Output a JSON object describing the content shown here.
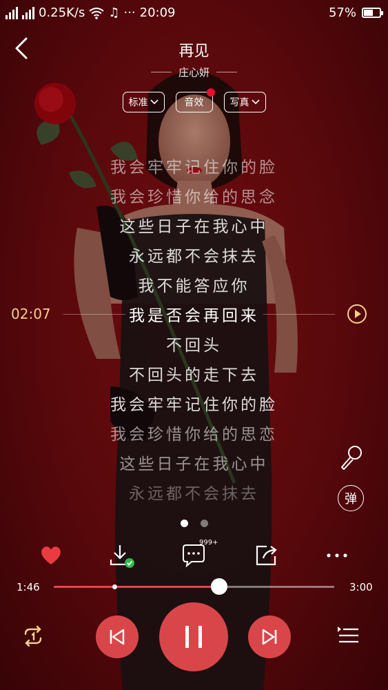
{
  "status_bar": {
    "network_speed": "0.25K/s",
    "time": "20:09",
    "battery": "57%",
    "battery_level": 0.57,
    "more": "···"
  },
  "player": {
    "title": "再见",
    "artist": "庄心妍",
    "tags": [
      {
        "label": "标准",
        "has_dropdown": true
      },
      {
        "label": "音效",
        "has_dot": true
      },
      {
        "label": "写真",
        "has_dropdown": true
      }
    ],
    "lyrics": [
      "我会牢牢记住你的脸",
      "我会珍惜你给的思念",
      "这些日子在我心中",
      "永远都不会抹去",
      "我不能答应你",
      "我是否会再回来",
      "不回头",
      "不回头的走下去",
      "我会牢牢记住你的脸",
      "我会珍惜你给的思恋",
      "这些日子在我心中",
      "永远都不会抹去"
    ],
    "seek_time": "02:07",
    "danmu_label": "弹",
    "comment_count": "999+",
    "current_time": "1:46",
    "total_time": "3:00",
    "progress": 0.589,
    "buffered": 0.215,
    "accent_color": "#d9464a",
    "highlight_color": "#f4d28a"
  },
  "icons": {
    "back": "chevron-left-icon",
    "favorite": "heart-icon",
    "download": "download-icon",
    "comment": "comment-icon",
    "share": "share-icon",
    "more": "more-icon",
    "loop": "repeat-icon",
    "prev": "previous-icon",
    "pause": "pause-icon",
    "next": "next-icon",
    "playlist": "playlist-icon",
    "mic": "microphone-icon"
  }
}
